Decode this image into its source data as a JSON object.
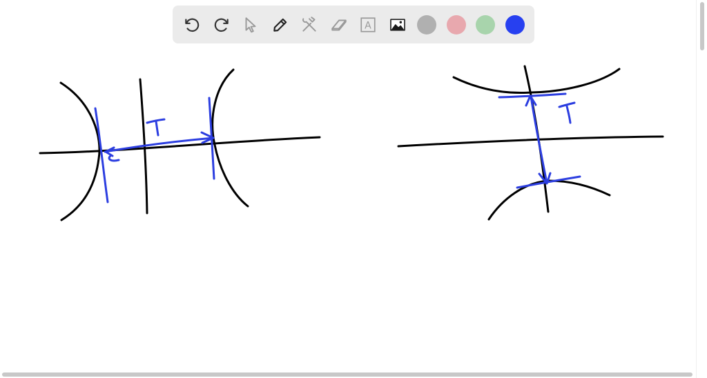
{
  "toolbar": {
    "tools": [
      {
        "name": "undo",
        "icon": "undo-icon"
      },
      {
        "name": "redo",
        "icon": "redo-icon"
      },
      {
        "name": "select",
        "icon": "pointer-icon"
      },
      {
        "name": "pen",
        "icon": "pen-icon"
      },
      {
        "name": "tools",
        "icon": "hammer-wrench-icon"
      },
      {
        "name": "eraser",
        "icon": "eraser-icon"
      },
      {
        "name": "text",
        "icon": "text-box-icon",
        "glyph": "A"
      },
      {
        "name": "image",
        "icon": "image-icon"
      }
    ],
    "colors": [
      "#b0b0b0",
      "#e8a8ae",
      "#a8d4ac",
      "#2740f0"
    ],
    "selected_color": "#2740f0"
  },
  "drawing": {
    "ink": "#000000",
    "accent": "#2c3ee0",
    "left_label": "T",
    "right_label": "T"
  }
}
